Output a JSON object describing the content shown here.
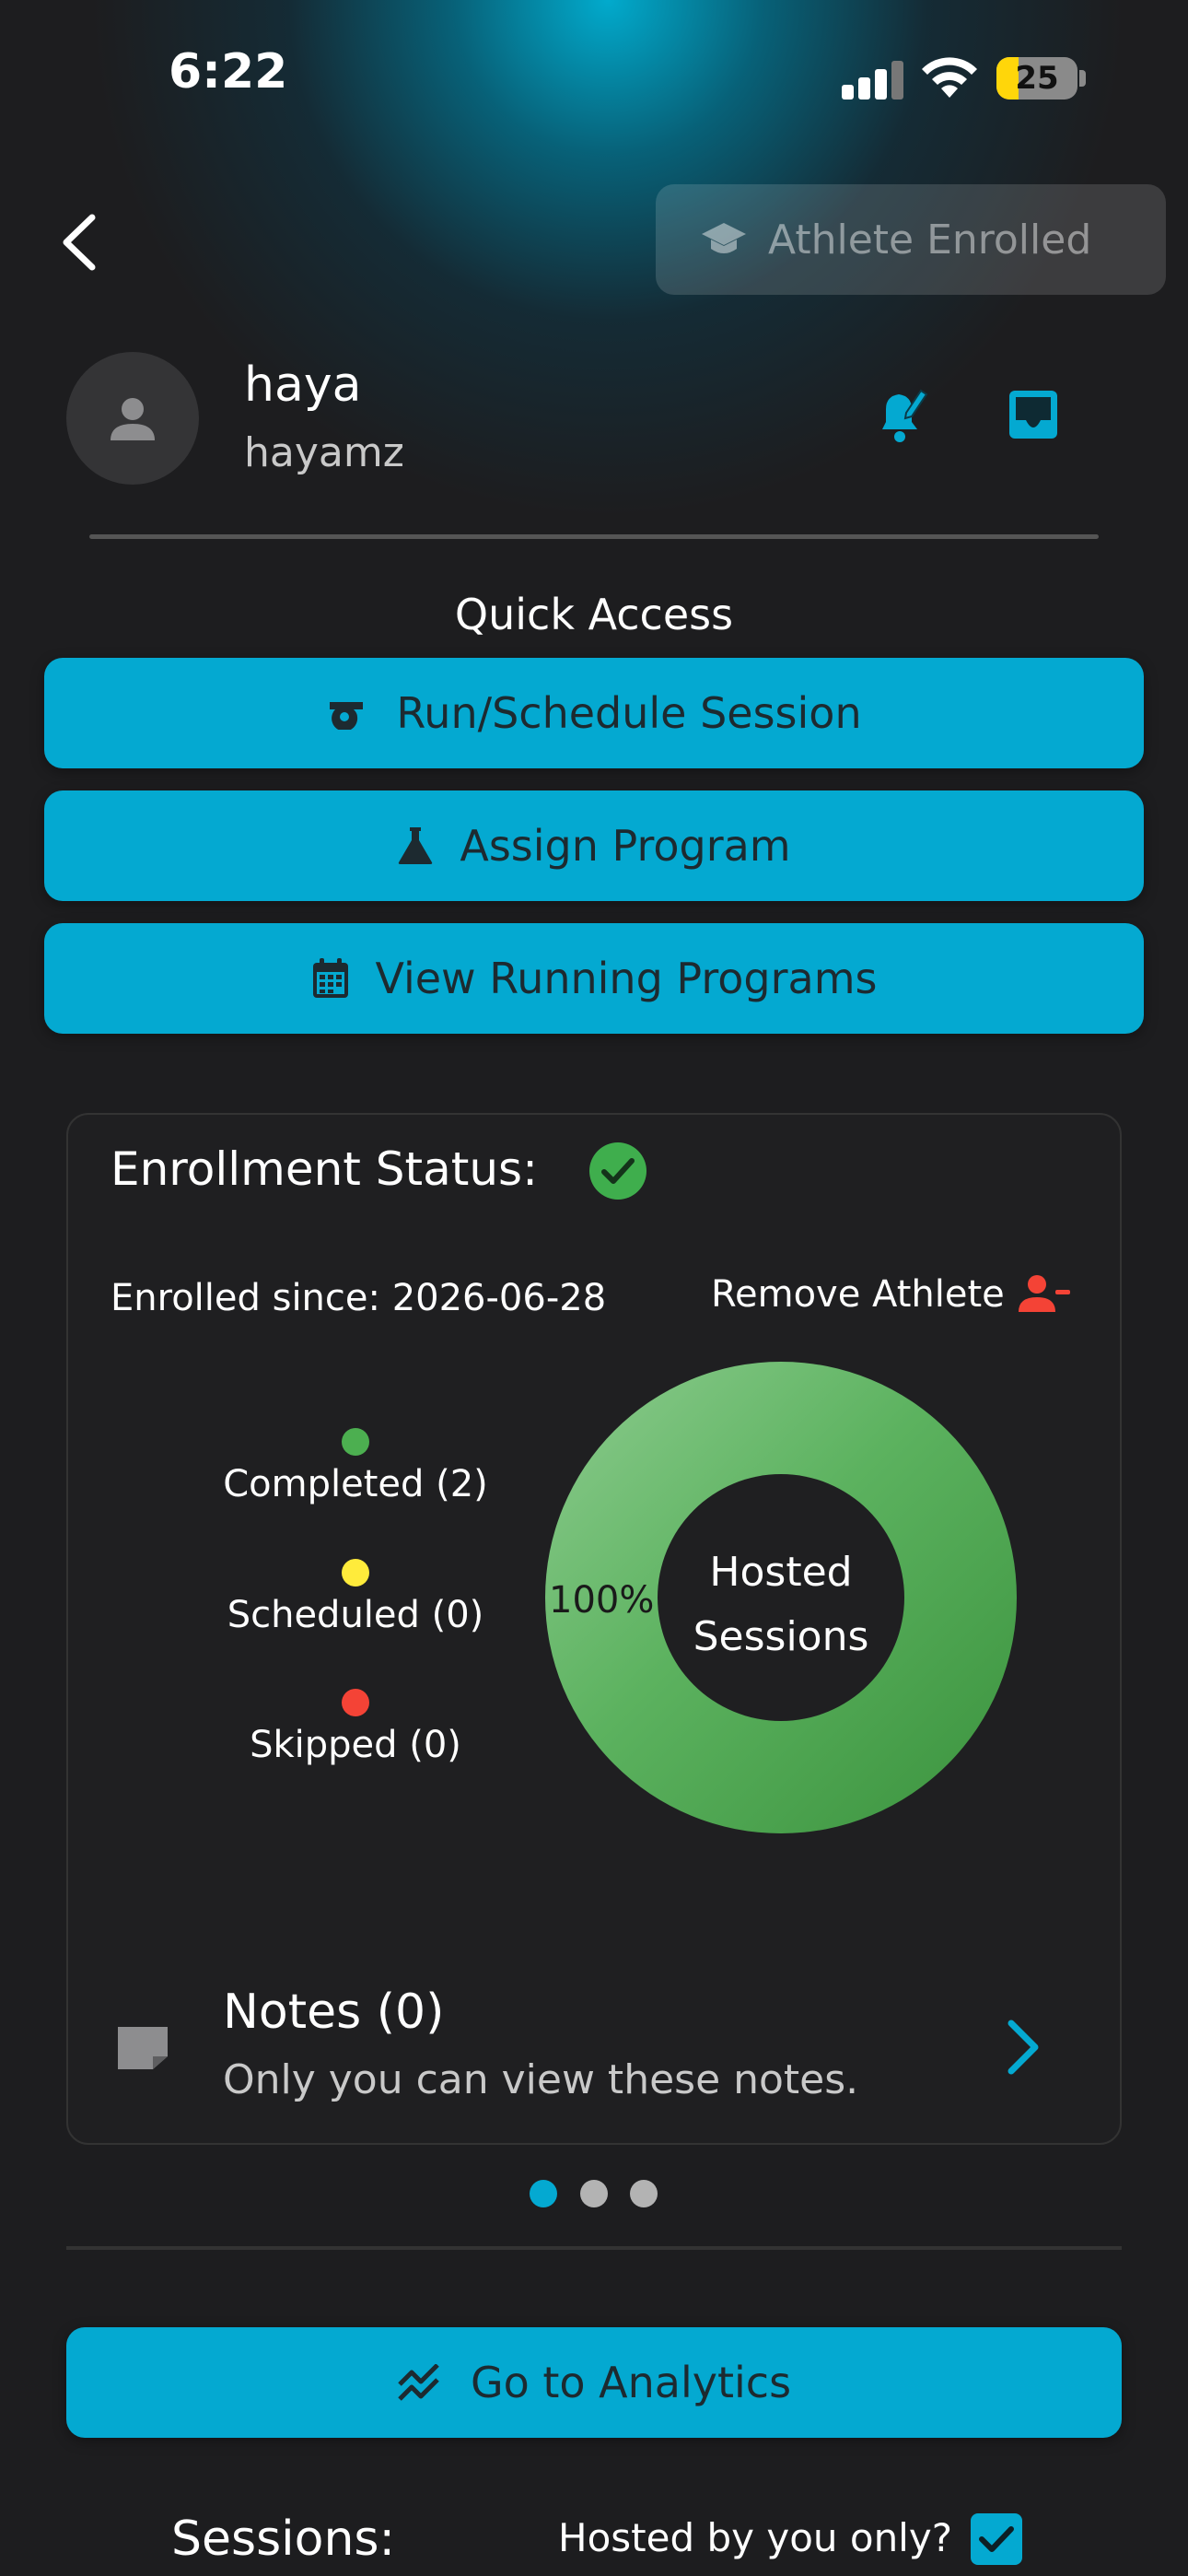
{
  "status_bar": {
    "time": "6:22",
    "battery": "25"
  },
  "header": {
    "enrolled_label": "Athlete Enrolled"
  },
  "profile": {
    "name": "haya",
    "username": "hayamz"
  },
  "quick_access": {
    "title": "Quick Access",
    "buttons": [
      {
        "label": "Run/Schedule Session",
        "icon": "whistle-icon"
      },
      {
        "label": "Assign Program",
        "icon": "flask-icon"
      },
      {
        "label": "View Running Programs",
        "icon": "calendar-icon"
      }
    ]
  },
  "enrollment": {
    "title": "Enrollment Status:",
    "since_label": "Enrolled since: 2026-06-28",
    "remove_label": "Remove Athlete",
    "legend": [
      {
        "label": "Completed (2)",
        "color": "#4caf50"
      },
      {
        "label": "Scheduled (0)",
        "color": "#ffeb3b"
      },
      {
        "label": "Skipped (0)",
        "color": "#f44336"
      }
    ],
    "donut_center_line1": "Hosted",
    "donut_center_line2": "Sessions",
    "donut_percent_label": "100%",
    "completed_fraction": 1.0
  },
  "notes": {
    "title": "Notes (0)",
    "subtitle": "Only you can view these notes."
  },
  "pager": {
    "count": 3,
    "active_index": 0
  },
  "analytics": {
    "label": "Go to Analytics"
  },
  "sessions": {
    "title": "Sessions:",
    "hosted_only_label": "Hosted by you only?",
    "hosted_only_checked": true
  },
  "colors": {
    "accent": "#04a9d1",
    "success": "#3fae4d",
    "danger": "#f44336"
  }
}
